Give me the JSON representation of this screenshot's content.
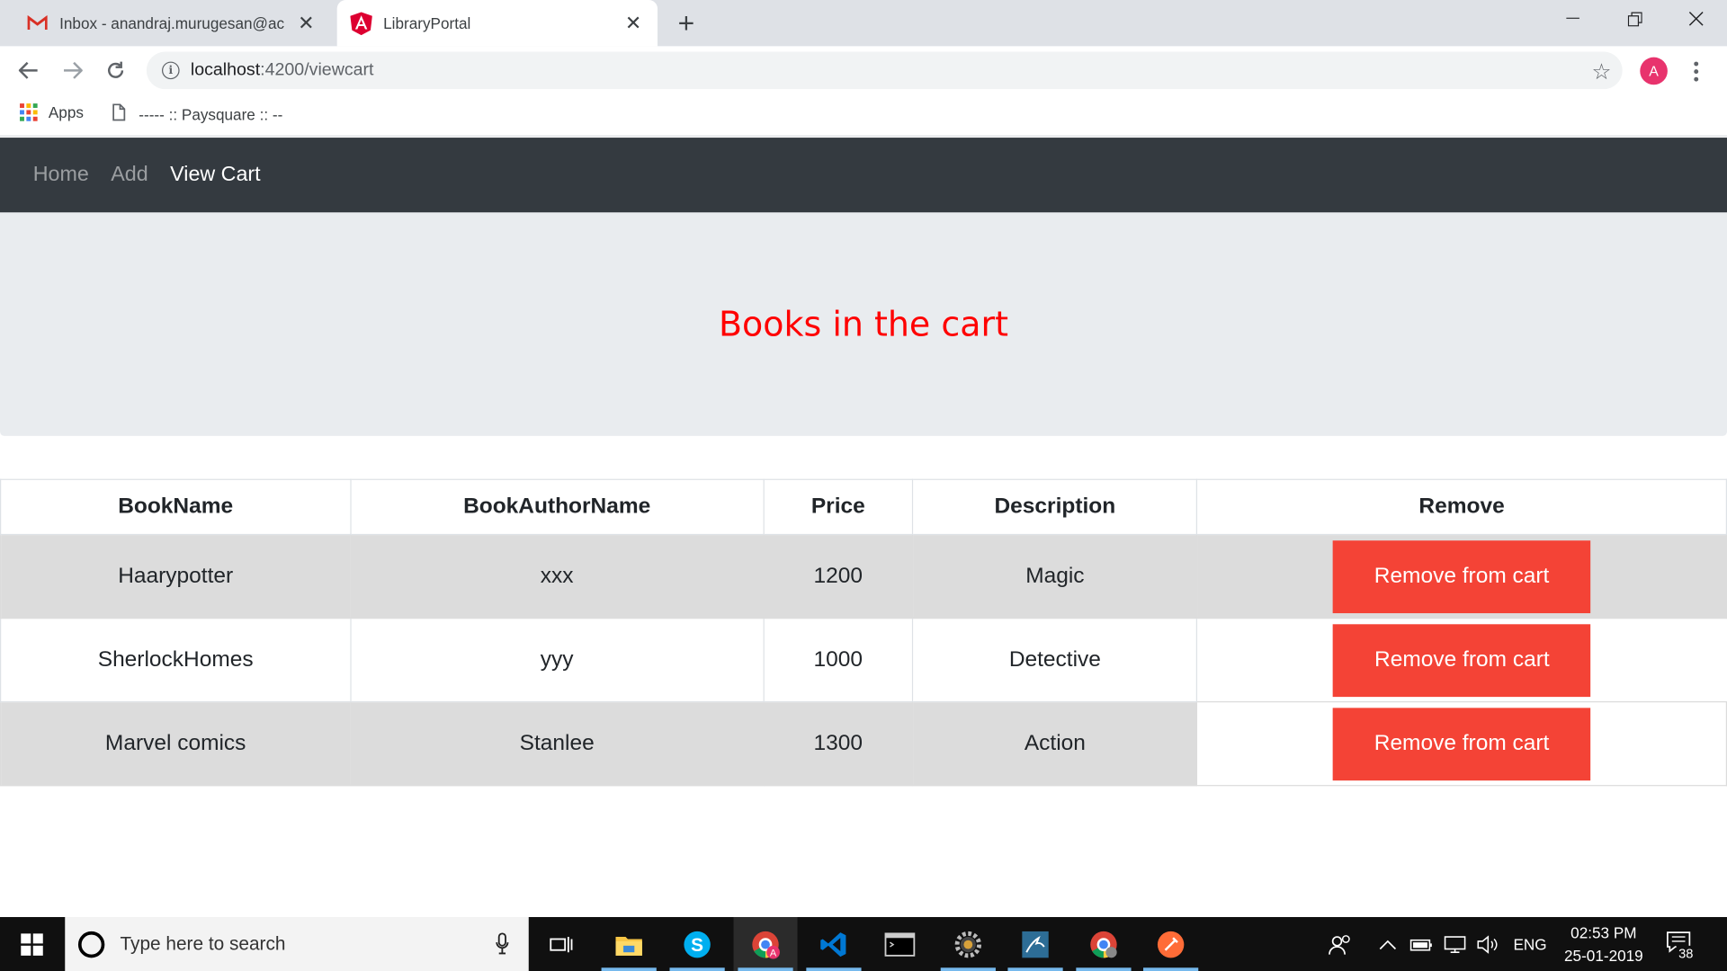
{
  "browser": {
    "tabs": [
      {
        "title": "Inbox - anandraj.murugesan@ac",
        "icon": "gmail-icon",
        "active": false
      },
      {
        "title": "LibraryPortal",
        "icon": "angular-icon",
        "active": true
      }
    ],
    "url_host": "localhost",
    "url_path": ":4200/viewcart",
    "profile_initial": "A",
    "bookmarks": [
      {
        "label": "Apps",
        "icon": "apps-grid-icon"
      },
      {
        "label": "----- :: Paysquare :: --",
        "icon": "page-icon"
      }
    ]
  },
  "navbar": {
    "links": [
      {
        "label": "Home",
        "active": false
      },
      {
        "label": "Add",
        "active": false
      },
      {
        "label": "View Cart",
        "active": true
      }
    ]
  },
  "jumbotron": {
    "heading": "Books in the cart",
    "heading_color": "#ff0000"
  },
  "table": {
    "headers": [
      "BookName",
      "BookAuthorName",
      "Price",
      "Description",
      "Remove"
    ],
    "rows": [
      {
        "name": "Haarypotter",
        "author": "xxx",
        "price": "1200",
        "description": "Magic",
        "action": "Remove from cart"
      },
      {
        "name": "SherlockHomes",
        "author": "yyy",
        "price": "1000",
        "description": "Detective",
        "action": "Remove from cart"
      },
      {
        "name": "Marvel comics",
        "author": "Stanlee",
        "price": "1300",
        "description": "Action",
        "action": "Remove from cart"
      }
    ],
    "button_color": "#f44336"
  },
  "taskbar": {
    "search_placeholder": "Type here to search",
    "language": "ENG",
    "time": "02:53 PM",
    "date": "25-01-2019",
    "notification_count": "38",
    "pinned": [
      "task-view-icon",
      "file-explorer-icon",
      "skype-icon",
      "chrome-icon",
      "vscode-icon",
      "terminal-icon",
      "settings-gear-icon",
      "mysql-workbench-icon",
      "chrome-icon",
      "postman-icon"
    ]
  }
}
